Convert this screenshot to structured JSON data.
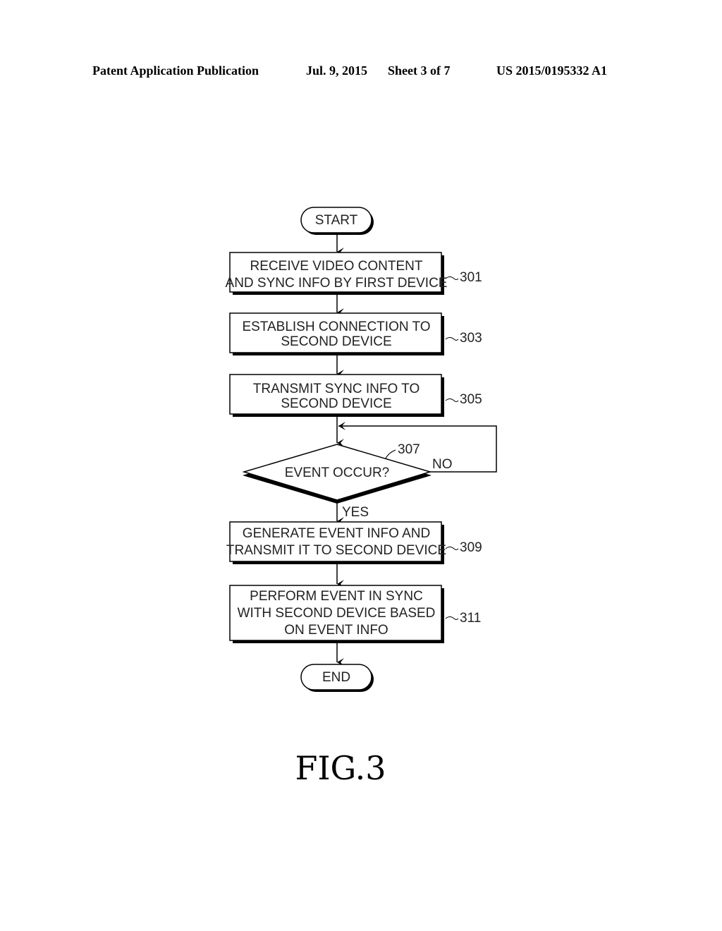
{
  "header": {
    "publication": "Patent Application Publication",
    "date": "Jul. 9, 2015",
    "sheet": "Sheet 3 of 7",
    "number": "US 2015/0195332 A1"
  },
  "flowchart": {
    "start": "START",
    "end": "END",
    "steps": [
      {
        "id": "301",
        "lines": [
          "RECEIVE VIDEO CONTENT",
          "AND SYNC INFO BY FIRST DEVICE"
        ]
      },
      {
        "id": "303",
        "lines": [
          "ESTABLISH CONNECTION TO",
          "SECOND DEVICE"
        ]
      },
      {
        "id": "305",
        "lines": [
          "TRANSMIT SYNC INFO TO",
          "SECOND DEVICE"
        ]
      },
      {
        "id": "309",
        "lines": [
          "GENERATE EVENT INFO AND",
          "TRANSMIT IT TO SECOND DEVICE"
        ]
      },
      {
        "id": "311",
        "lines": [
          "PERFORM EVENT IN SYNC",
          "WITH SECOND DEVICE BASED",
          "ON EVENT INFO"
        ]
      }
    ],
    "decision": {
      "id": "307",
      "text": "EVENT OCCUR?",
      "yes": "YES",
      "no": "NO"
    }
  },
  "figure_label": "FIG.3"
}
